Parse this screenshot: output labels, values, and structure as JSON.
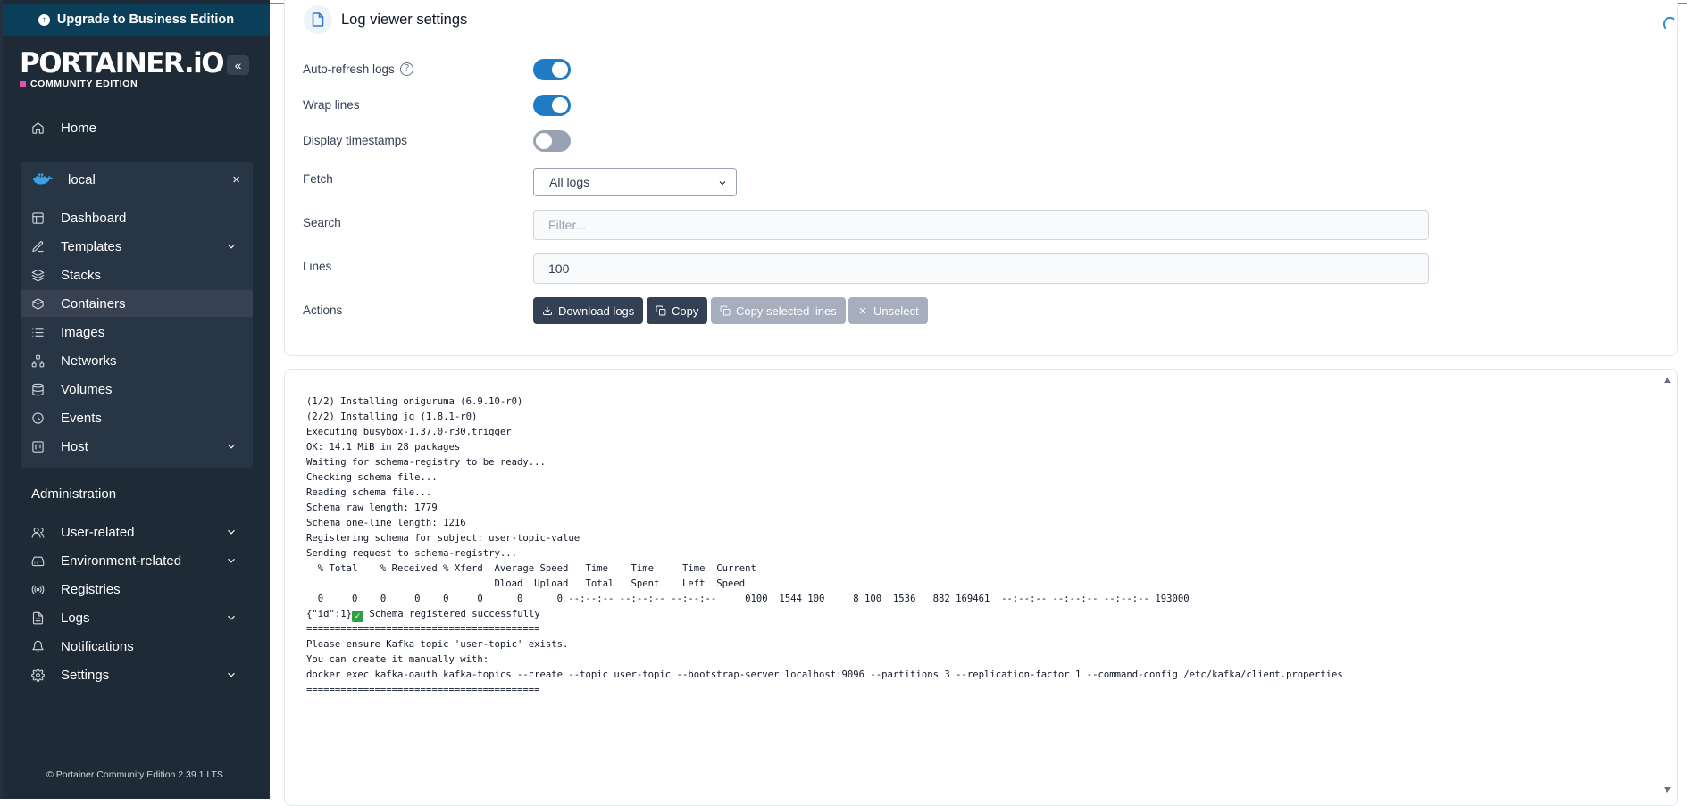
{
  "sidebar": {
    "upgrade_label": "Upgrade to Business Edition",
    "brand": "PORTAINER.iO",
    "edition": "COMMUNITY EDITION",
    "collapse_icon": "«",
    "home": "Home",
    "environment": {
      "name": "local",
      "close": "×"
    },
    "env_items": {
      "dashboard": "Dashboard",
      "templates": "Templates",
      "stacks": "Stacks",
      "containers": "Containers",
      "images": "Images",
      "networks": "Networks",
      "volumes": "Volumes",
      "events": "Events",
      "host": "Host"
    },
    "administration": "Administration",
    "admin_items": {
      "user_related": "User-related",
      "environment_related": "Environment-related",
      "registries": "Registries",
      "logs": "Logs",
      "notifications": "Notifications",
      "settings": "Settings"
    },
    "footer": "© Portainer Community Edition 2.39.1 LTS",
    "active_item": "Containers"
  },
  "settings": {
    "title": "Log viewer settings",
    "auto_refresh_label": "Auto-refresh logs",
    "auto_refresh_on": true,
    "wrap_lines_label": "Wrap lines",
    "wrap_lines_on": true,
    "display_timestamps_label": "Display timestamps",
    "display_timestamps_on": false,
    "fetch_label": "Fetch",
    "fetch_value": "All logs",
    "search_label": "Search",
    "search_placeholder": "Filter...",
    "lines_label": "Lines",
    "lines_value": "100",
    "actions_label": "Actions",
    "buttons": {
      "download": "Download logs",
      "copy": "Copy",
      "copy_selected": "Copy selected lines",
      "unselect": "Unselect"
    }
  },
  "logs": {
    "lines": [
      "(1/2) Installing oniguruma (6.9.10-r0)",
      "(2/2) Installing jq (1.8.1-r0)",
      "Executing busybox-1.37.0-r30.trigger",
      "OK: 14.1 MiB in 28 packages",
      "Waiting for schema-registry to be ready...",
      "Checking schema file...",
      "Reading schema file...",
      "Schema raw length: 1779",
      "Schema one-line length: 1216",
      "Registering schema for subject: user-topic-value",
      "Sending request to schema-registry...",
      "  % Total    % Received % Xferd  Average Speed   Time    Time     Time  Current",
      "                                 Dload  Upload   Total   Spent    Left  Speed",
      "  0     0    0     0    0     0      0      0 --:--:-- --:--:-- --:--:--     0100  1544 100     8 100  1536   882 169461  --:--:-- --:--:-- --:--:-- 193000"
    ],
    "success_prefix": "{\"id\":1}",
    "success_text": " Schema registered successfully",
    "lines_after": [
      "=========================================",
      "Please ensure Kafka topic 'user-topic' exists.",
      "You can create it manually with:",
      "docker exec kafka-oauth kafka-topics --create --topic user-topic --bootstrap-server localhost:9096 --partitions 3 --replication-factor 1 --command-config /etc/kafka/client.properties",
      "========================================="
    ]
  }
}
